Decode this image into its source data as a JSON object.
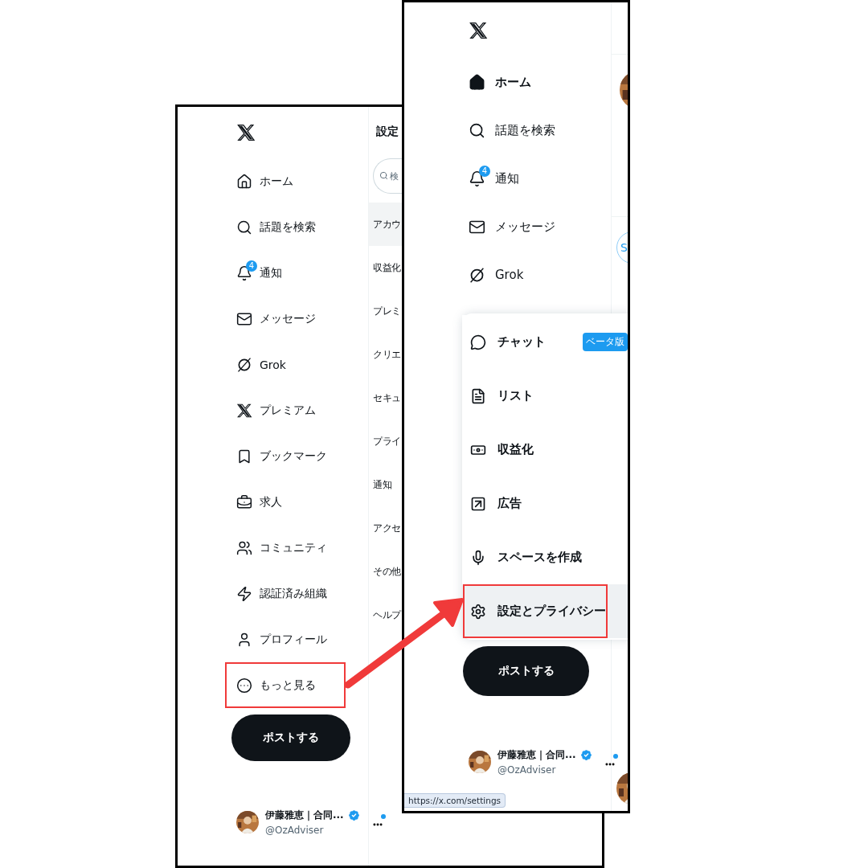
{
  "left_screen": {
    "nav": [
      {
        "label": "ホーム",
        "selected": false,
        "annotated": false
      },
      {
        "label": "話題を検索",
        "selected": false,
        "annotated": false
      },
      {
        "label": "通知",
        "selected": false,
        "annotated": false,
        "badge": "4"
      },
      {
        "label": "メッセージ",
        "selected": false,
        "annotated": false
      },
      {
        "label": "Grok",
        "selected": false,
        "annotated": false
      },
      {
        "label": "プレミアム",
        "selected": false,
        "annotated": false
      },
      {
        "label": "ブックマーク",
        "selected": false,
        "annotated": false
      },
      {
        "label": "求人",
        "selected": false,
        "annotated": false
      },
      {
        "label": "コミュニティ",
        "selected": false,
        "annotated": false
      },
      {
        "label": "認証済み組織",
        "selected": false,
        "annotated": false
      },
      {
        "label": "プロフィール",
        "selected": false,
        "annotated": false
      },
      {
        "label": "もっと見る",
        "selected": false,
        "annotated": true
      }
    ],
    "post_button": "ポストする",
    "account": {
      "name": "伊藤雅恵｜合同...",
      "handle": "@OzAdviser",
      "verified": true,
      "unread": true
    },
    "settings": {
      "title": "設定",
      "search": {
        "placeholder": "検"
      },
      "items": [
        {
          "label": "アカウ",
          "selected": true
        },
        {
          "label": "収益化",
          "selected": false
        },
        {
          "label": "プレミ",
          "selected": false
        },
        {
          "label": "クリエ",
          "selected": false
        },
        {
          "label": "セキュ",
          "selected": false
        },
        {
          "label": "プライ",
          "selected": false
        },
        {
          "label": "通知",
          "selected": false
        },
        {
          "label": "アクセ",
          "selected": false
        },
        {
          "label": "その他",
          "selected": false
        },
        {
          "label": "ヘルプ",
          "selected": false
        }
      ]
    }
  },
  "right_screen": {
    "nav": [
      {
        "label": "ホーム",
        "selected": true,
        "annotated": false
      },
      {
        "label": "話題を検索",
        "selected": false,
        "annotated": false
      },
      {
        "label": "通知",
        "selected": false,
        "annotated": false,
        "badge": "4"
      },
      {
        "label": "メッセージ",
        "selected": false,
        "annotated": false
      },
      {
        "label": "Grok",
        "selected": false,
        "annotated": false
      }
    ],
    "more_menu": [
      {
        "label": "チャット",
        "badge": "ベータ版",
        "hovered": false,
        "annotated": false
      },
      {
        "label": "リスト",
        "hovered": false,
        "annotated": false
      },
      {
        "label": "収益化",
        "hovered": false,
        "annotated": false
      },
      {
        "label": "広告",
        "hovered": false,
        "annotated": false
      },
      {
        "label": "スペースを作成",
        "hovered": false,
        "annotated": false
      },
      {
        "label": "設定とプライバシー",
        "hovered": true,
        "annotated": true
      }
    ],
    "post_button": "ポストする",
    "account": {
      "name": "伊藤雅恵｜合同...",
      "handle": "@OzAdviser",
      "verified": true,
      "unread": true
    },
    "timeline": {
      "chip": "S"
    },
    "status_url": "https://x.com/settings"
  },
  "arrow": true
}
